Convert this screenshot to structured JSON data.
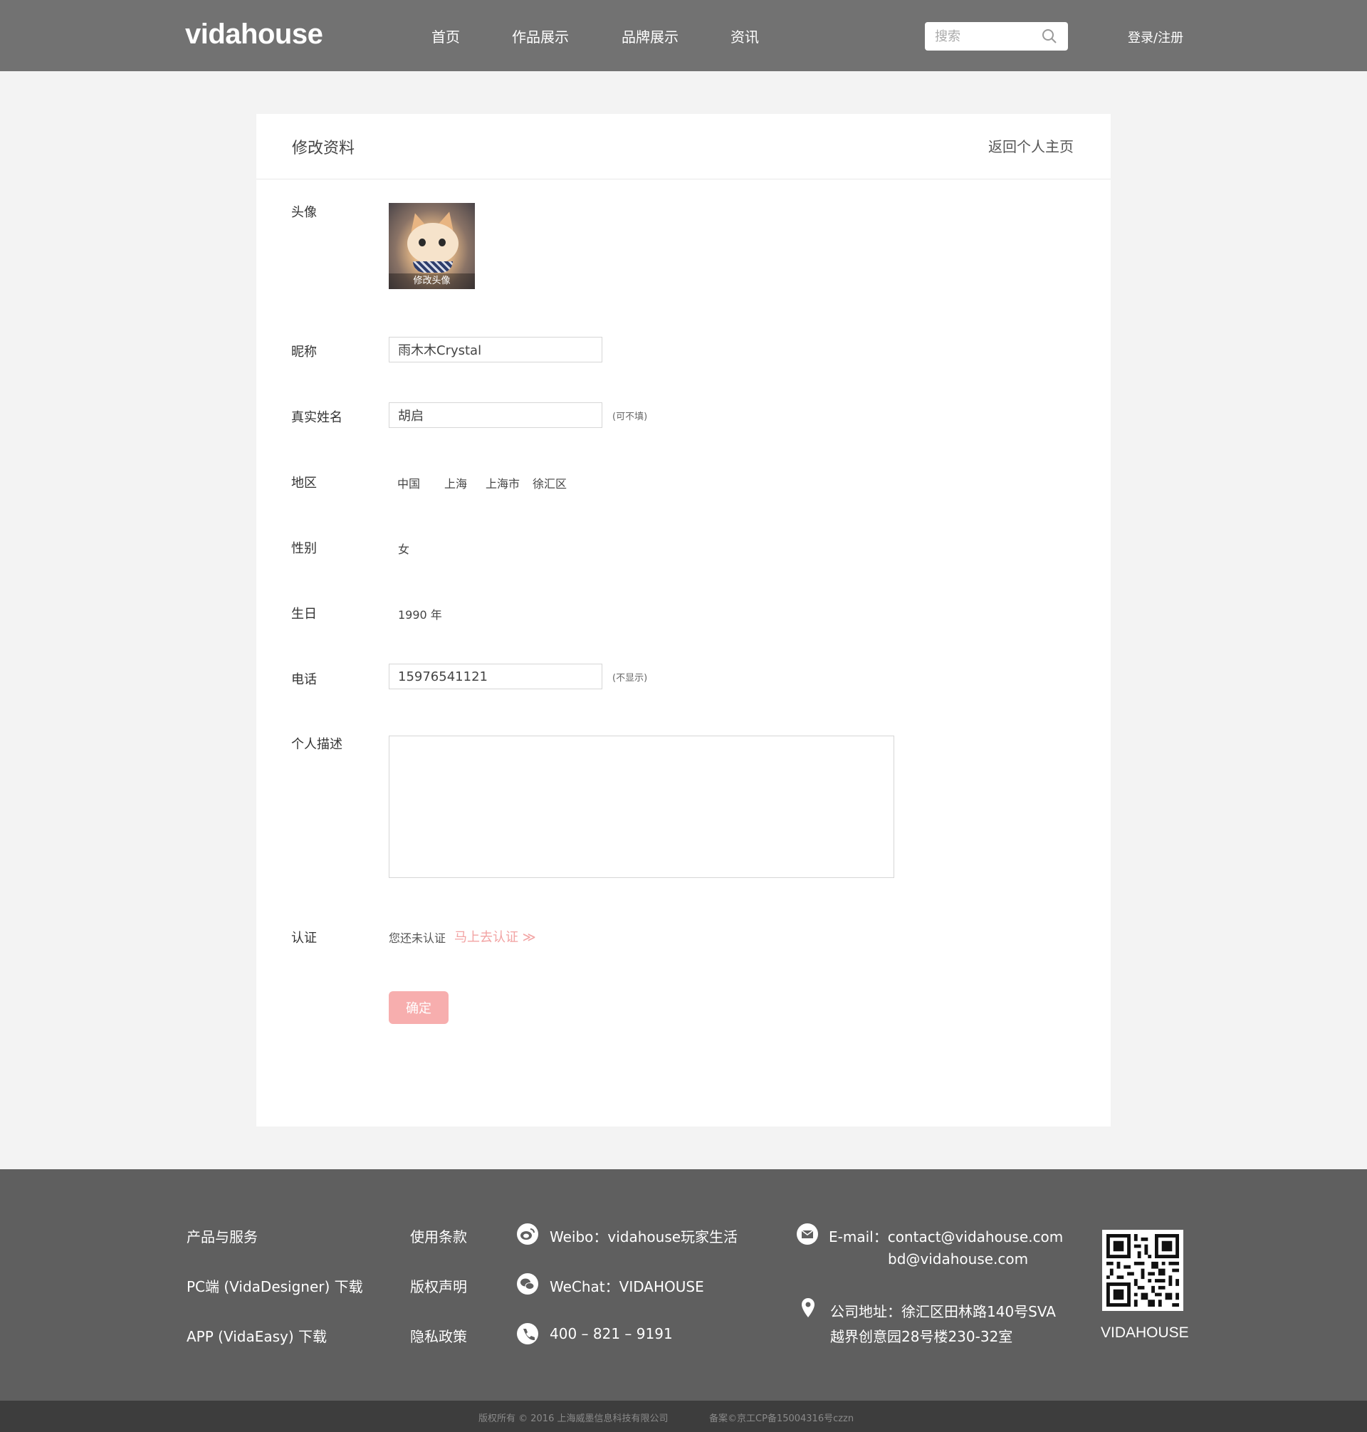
{
  "header": {
    "logo": "vidahouse",
    "nav": [
      "首页",
      "作品展示",
      "品牌展示",
      "资讯"
    ],
    "search_placeholder": "搜索",
    "login": "登录/注册"
  },
  "card": {
    "title": "修改资料",
    "back": "返回个人主页",
    "labels": {
      "avatar": "头像",
      "nickname": "昵称",
      "realname": "真实姓名",
      "region": "地区",
      "gender": "性别",
      "birthday": "生日",
      "phone": "电话",
      "bio": "个人描述",
      "cert": "认证"
    },
    "avatar_caption": "修改头像",
    "nickname_value": "雨木木Crystal",
    "realname_value": "胡启",
    "realname_hint": "(可不填)",
    "region": [
      "中国",
      "上海",
      "上海市",
      "徐汇区"
    ],
    "gender_value": "女",
    "birthday_value": "1990 年",
    "phone_value": "15976541121",
    "phone_hint": "(不显示)",
    "bio_value": "",
    "cert_status": "您还未认证",
    "cert_link": "马上去认证 ≫",
    "confirm": "确定"
  },
  "footer": {
    "col1": [
      "产品与服务",
      "PC端 (VidaDesigner) 下载",
      "APP (VidaEasy) 下载"
    ],
    "col2": [
      "使用条款",
      "版权声明",
      "隐私政策"
    ],
    "weibo": "Weibo：vidahouse玩家生活",
    "wechat": "WeChat：VIDAHOUSE",
    "phone": "400 – 821 – 9191",
    "email_line1": "E-mail：contact@vidahouse.com",
    "email_line2": "bd@vidahouse.com",
    "address_line1": "公司地址：徐汇区田林路140号SVA",
    "address_line2": "越界创意园28号楼230-32室",
    "qr_brand": "VIDAHOUSE",
    "copyright": "版权所有 © 2016 上海威墨信息科技有限公司",
    "icp": "备案©京工CP备15004316号czzn",
    "icons": [
      "weibo-icon",
      "wechat-icon",
      "phone-icon",
      "mail-icon",
      "location-icon"
    ]
  },
  "colors": {
    "header_bg": "#727272",
    "footer_bg": "#5f5f5f",
    "accent_pink": "#f7aeae"
  }
}
